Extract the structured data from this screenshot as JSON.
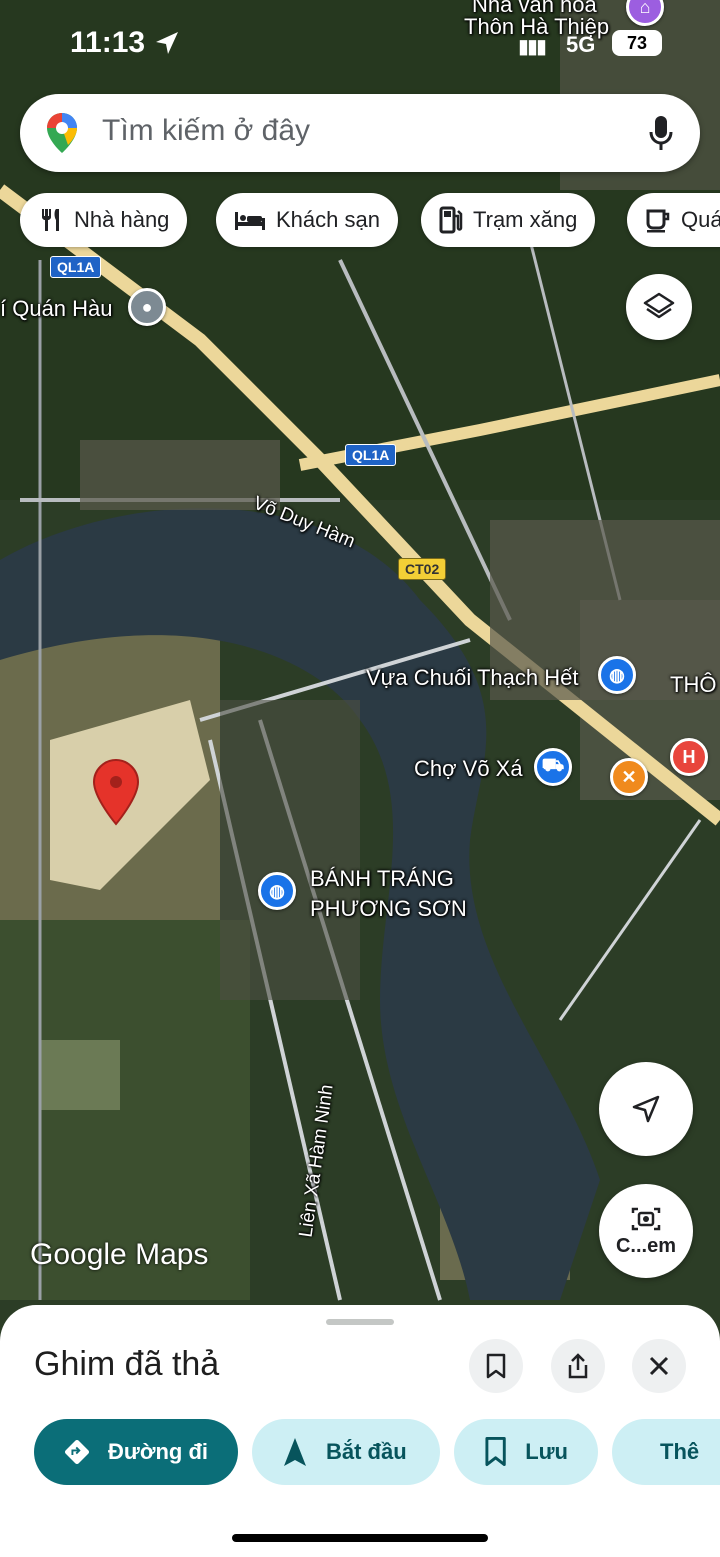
{
  "status": {
    "time": "11:13",
    "network": "5G",
    "battery": "73"
  },
  "search": {
    "placeholder": "Tìm kiếm ở đây"
  },
  "chips": [
    {
      "label": "Nhà hàng",
      "icon": "fork-knife-icon"
    },
    {
      "label": "Khách sạn",
      "icon": "bed-icon"
    },
    {
      "label": "Trạm xăng",
      "icon": "fuel-icon"
    },
    {
      "label": "Quá",
      "icon": "coffee-icon"
    }
  ],
  "map": {
    "labels": {
      "top_village_1": "Nhà văn hóa",
      "top_village_2": "Thôn Hà Thiệp",
      "quan_hau": "í Quán Hàu",
      "vo_duy_ham": "Võ Duy Hàm",
      "vua_chuoi": "Vựa Chuối Thạch Hết",
      "tho": "THÔ",
      "cho_vo_xa": "Chợ Võ Xá",
      "banh_trang_1": "BÁNH TRÁNG",
      "banh_trang_2": "PHƯƠNG SƠN",
      "lien_xa": "Liên Xã Hàm Ninh"
    },
    "shields": {
      "ql1a_top": "QL1A",
      "ql1a_mid": "QL1A",
      "ct02": "CT02"
    },
    "logo": "Google Maps",
    "camera_label": "C...em"
  },
  "sheet": {
    "title": "Ghim đã thả",
    "actions": [
      {
        "label": "Đường đi"
      },
      {
        "label": "Bắt đầu"
      },
      {
        "label": "Lưu"
      },
      {
        "label": "Thê"
      }
    ]
  },
  "colors": {
    "accent": "#0b6e78",
    "secondary_bg": "#cdeff4",
    "pin_red": "#e5332a"
  }
}
